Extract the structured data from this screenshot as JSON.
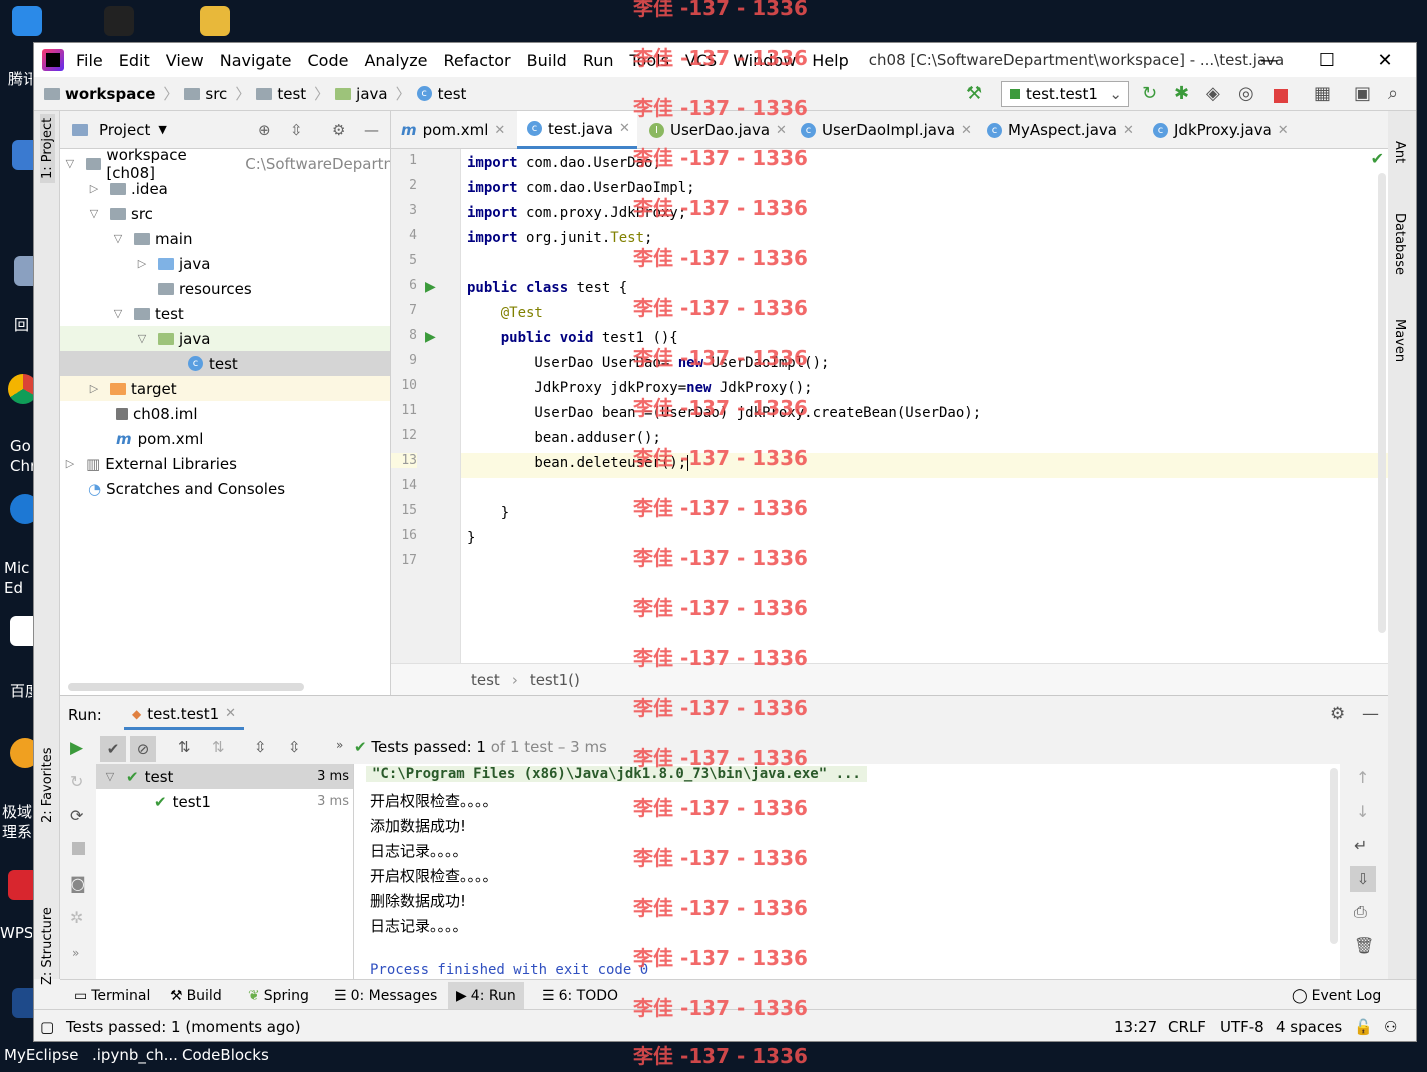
{
  "desktop": {
    "labels": [
      "腾讯",
      "回",
      "Go Chr",
      "Mic Ed",
      "百度",
      "极域 理系",
      "WPS",
      "MyEclipse",
      ".ipynb_ch...",
      "CodeBlocks"
    ]
  },
  "window": {
    "title": "ch08 [C:\\SoftwareDepartment\\workspace] - ...\\test.java",
    "menu": [
      "File",
      "Edit",
      "View",
      "Navigate",
      "Code",
      "Analyze",
      "Refactor",
      "Build",
      "Run",
      "Tools",
      "VCS",
      "Window",
      "Help"
    ]
  },
  "nav": {
    "crumbs": [
      "workspace",
      "src",
      "test",
      "java",
      "test"
    ],
    "run_config": "test.test1"
  },
  "left_strip": {
    "project_tab": "1: Project",
    "favorites_tab": "2: Favorites",
    "structure_tab": "Z: Structure"
  },
  "right_strip": {
    "ant": "Ant",
    "database": "Database",
    "maven": "Maven"
  },
  "project": {
    "title": "Project",
    "tree": [
      {
        "label": "workspace [ch08]",
        "extra": "C:\\SoftwareDepartn"
      },
      {
        "label": ".idea"
      },
      {
        "label": "src"
      },
      {
        "label": "main"
      },
      {
        "label": "java"
      },
      {
        "label": "resources"
      },
      {
        "label": "test"
      },
      {
        "label": "java"
      },
      {
        "label": "test"
      },
      {
        "label": "target"
      },
      {
        "label": "ch08.iml"
      },
      {
        "label": "pom.xml"
      },
      {
        "label": "External Libraries"
      },
      {
        "label": "Scratches and Consoles"
      }
    ]
  },
  "tabs": [
    "pom.xml",
    "test.java",
    "UserDao.java",
    "UserDaoImpl.java",
    "MyAspect.java",
    "JdkProxy.java"
  ],
  "editor": {
    "line_numbers": [
      "1",
      "2",
      "3",
      "4",
      "5",
      "6",
      "7",
      "8",
      "9",
      "10",
      "11",
      "12",
      "13",
      "14",
      "15",
      "16",
      "17"
    ],
    "lines": [
      {
        "kw": "import",
        "rest": " com.dao.UserDao;"
      },
      {
        "kw": "import",
        "rest": " com.dao.UserDaoImpl;"
      },
      {
        "kw": "import",
        "rest": " com.proxy.JdkProxy;"
      },
      {
        "kw": "import",
        "rest": " org.junit.",
        "ann": "Test",
        "tail": ";"
      },
      {
        "kw": "",
        "rest": ""
      },
      {
        "kw": "public class",
        "rest": " test {"
      },
      {
        "kw": "",
        "rest": "    ",
        "ann": "@Test"
      },
      {
        "kw": "    public void",
        "rest": " test1 (){"
      },
      {
        "kw": "",
        "rest": "        UserDao UserDao= ",
        "kw2": "new",
        "tail": " UserDaoImpl();"
      },
      {
        "kw": "",
        "rest": "        JdkProxy jdkProxy=",
        "kw2": "new",
        "tail": " JdkProxy();"
      },
      {
        "kw": "",
        "rest": "        UserDao bean =(UserDao) jdkProxy.createBean(UserDao);"
      },
      {
        "kw": "",
        "rest": "        bean.adduser();"
      },
      {
        "kw": "",
        "rest": "        bean.deleteuser();"
      },
      {
        "kw": "",
        "rest": ""
      },
      {
        "kw": "",
        "rest": "    }"
      },
      {
        "kw": "",
        "rest": "}"
      },
      {
        "kw": "",
        "rest": ""
      }
    ],
    "breadcrumb": [
      "test",
      "test1()"
    ]
  },
  "run": {
    "label": "Run:",
    "tab": "test.test1",
    "status_prefix": "Tests passed:",
    "status_count": "1",
    "status_suffix": "of 1 test – 3 ms",
    "tree": [
      {
        "label": "test",
        "time": "3 ms"
      },
      {
        "label": "test1",
        "time": "3 ms"
      }
    ],
    "console": [
      "\"C:\\Program Files (x86)\\Java\\jdk1.8.0_73\\bin\\java.exe\" ...",
      "开启权限检查。。。。",
      "添加数据成功!",
      "日志记录。。。。",
      "开启权限检查。。。。",
      "删除数据成功!",
      "日志记录。。。。",
      "",
      "Process finished with exit code 0"
    ]
  },
  "bottom_tabs": [
    "Terminal",
    "Build",
    "Spring",
    "0: Messages",
    "4: Run",
    "6: TODO"
  ],
  "event_log": "Event Log",
  "status": {
    "message": "Tests passed: 1 (moments ago)",
    "position": "13:27",
    "line_sep": "CRLF",
    "encoding": "UTF-8",
    "indent": "4 spaces"
  },
  "watermark": "李佳 -137 - 1336",
  "colors": {
    "accent": "#4083c9",
    "keyword": "#000080",
    "annotation": "#808000",
    "watermark": "#f05050",
    "success": "#3b9a3b"
  }
}
